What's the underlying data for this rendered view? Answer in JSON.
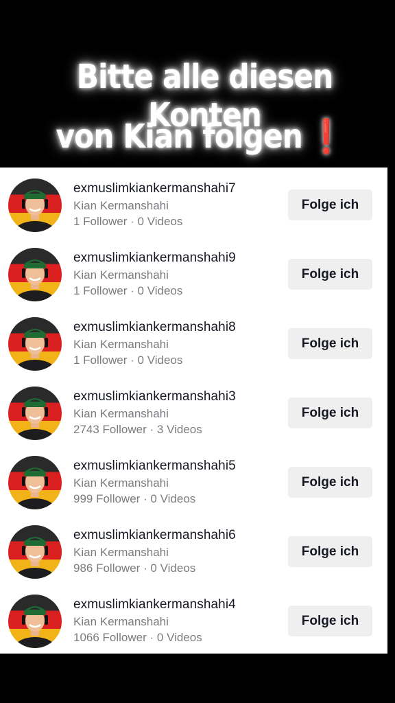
{
  "header": {
    "title_line1": "Bitte alle diesen Konten",
    "title_line2": "von Kian folgen",
    "title_emoji": "❗"
  },
  "accounts": [
    {
      "username": "exmuslimkiankermanshahi7",
      "display_name": "Kian Kermanshahi",
      "stats": "1 Follower · 0 Videos",
      "button": "Folge ich"
    },
    {
      "username": "exmuslimkiankermanshahi9",
      "display_name": "Kian Kermanshahi",
      "stats": "1 Follower · 0 Videos",
      "button": "Folge ich"
    },
    {
      "username": "exmuslimkiankermanshahi8",
      "display_name": "Kian Kermanshahi",
      "stats": "1 Follower · 0 Videos",
      "button": "Folge ich"
    },
    {
      "username": "exmuslimkiankermanshahi3",
      "display_name": "Kian Kermanshahi",
      "stats": "2743 Follower · 3 Videos",
      "button": "Folge ich"
    },
    {
      "username": "exmuslimkiankermanshahi5",
      "display_name": "Kian Kermanshahi",
      "stats": "999 Follower · 0 Videos",
      "button": "Folge ich"
    },
    {
      "username": "exmuslimkiankermanshahi6",
      "display_name": "Kian Kermanshahi",
      "stats": "986 Follower · 0 Videos",
      "button": "Folge ich"
    },
    {
      "username": "exmuslimkiankermanshahi4",
      "display_name": "Kian Kermanshahi",
      "stats": "1066 Follower · 0 Videos",
      "button": "Folge ich"
    }
  ],
  "colors": {
    "background": "#000000",
    "list_background": "#ffffff",
    "title_text": "#ffffff",
    "emoji_red": "#e3141c",
    "username_text": "#161823",
    "secondary_text": "#7c7c80",
    "button_background": "#efeff0",
    "avatar_flag": [
      "#2a2a2a",
      "#d91f1f",
      "#f2b318"
    ]
  }
}
